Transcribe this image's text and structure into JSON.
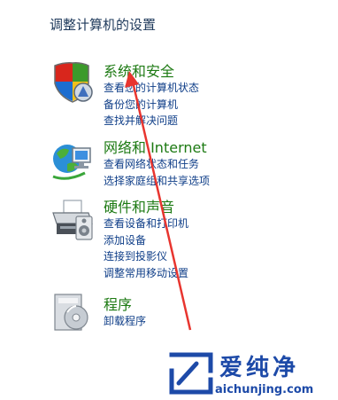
{
  "page": {
    "title": "调整计算机的设置"
  },
  "categories": [
    {
      "icon": "shield-icon",
      "title": "系统和安全",
      "links": [
        "查看您的计算机状态",
        "备份您的计算机",
        "查找并解决问题"
      ]
    },
    {
      "icon": "network-globe-icon",
      "title": "网络和 Internet",
      "links": [
        "查看网络状态和任务",
        "选择家庭组和共享选项"
      ]
    },
    {
      "icon": "printer-icon",
      "title": "硬件和声音",
      "links": [
        "查看设备和打印机",
        "添加设备",
        "连接到投影仪",
        "调整常用移动设置"
      ]
    },
    {
      "icon": "programs-icon",
      "title": "程序",
      "links": [
        "卸载程序"
      ]
    }
  ],
  "annotation": {
    "arrow_color": "#e8352f"
  },
  "watermark": {
    "brand": "爱纯净",
    "domain": "aichunjing.com"
  },
  "colors": {
    "title_text": "#1e395b",
    "category_title": "#1d7a13",
    "link": "#0f3e88",
    "watermark": "#1d4aa8"
  }
}
